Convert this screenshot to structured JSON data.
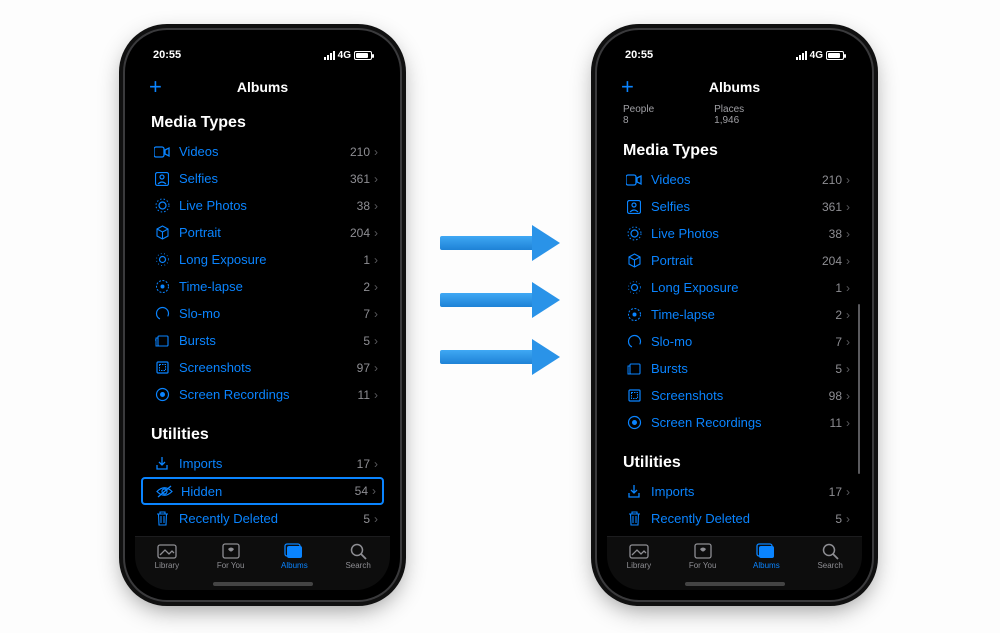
{
  "status": {
    "time": "20:55",
    "net_label": "4G"
  },
  "nav": {
    "title": "Albums",
    "plus": "+"
  },
  "sections": {
    "media_types": "Media Types",
    "utilities": "Utilities"
  },
  "left_phone": {
    "media": [
      {
        "label": "Videos",
        "count": "210"
      },
      {
        "label": "Selfies",
        "count": "361"
      },
      {
        "label": "Live Photos",
        "count": "38"
      },
      {
        "label": "Portrait",
        "count": "204"
      },
      {
        "label": "Long Exposure",
        "count": "1"
      },
      {
        "label": "Time-lapse",
        "count": "2"
      },
      {
        "label": "Slo-mo",
        "count": "7"
      },
      {
        "label": "Bursts",
        "count": "5"
      },
      {
        "label": "Screenshots",
        "count": "97"
      },
      {
        "label": "Screen Recordings",
        "count": "11"
      }
    ],
    "utilities": [
      {
        "label": "Imports",
        "count": "17"
      },
      {
        "label": "Hidden",
        "count": "54"
      },
      {
        "label": "Recently Deleted",
        "count": "5"
      }
    ]
  },
  "right_phone": {
    "top_labels": {
      "people_label": "People",
      "people_count": "8",
      "places_label": "Places",
      "places_count": "1,946"
    },
    "media": [
      {
        "label": "Videos",
        "count": "210"
      },
      {
        "label": "Selfies",
        "count": "361"
      },
      {
        "label": "Live Photos",
        "count": "38"
      },
      {
        "label": "Portrait",
        "count": "204"
      },
      {
        "label": "Long Exposure",
        "count": "1"
      },
      {
        "label": "Time-lapse",
        "count": "2"
      },
      {
        "label": "Slo-mo",
        "count": "7"
      },
      {
        "label": "Bursts",
        "count": "5"
      },
      {
        "label": "Screenshots",
        "count": "98"
      },
      {
        "label": "Screen Recordings",
        "count": "11"
      }
    ],
    "utilities": [
      {
        "label": "Imports",
        "count": "17"
      },
      {
        "label": "Recently Deleted",
        "count": "5"
      }
    ]
  },
  "tabs": {
    "library": "Library",
    "for_you": "For You",
    "albums": "Albums",
    "search": "Search"
  },
  "accent": "#0a84ff"
}
